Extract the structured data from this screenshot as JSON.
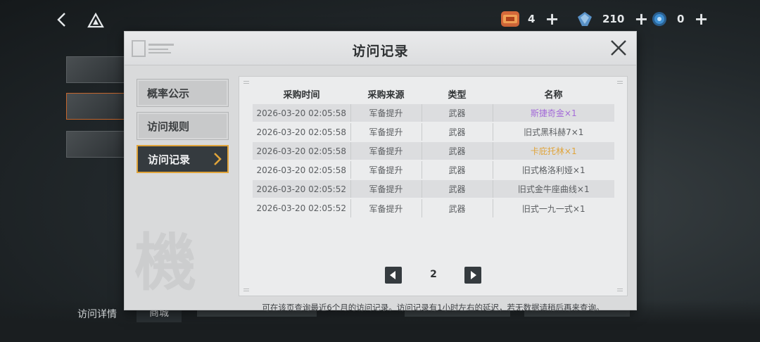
{
  "topbar": {
    "resources": [
      {
        "icon": "ticket-icon",
        "value": "4",
        "color": "#d4683a"
      },
      {
        "icon": "crystal-icon",
        "value": "210",
        "color": "#5a93c9"
      },
      {
        "icon": "coin-icon",
        "value": "0",
        "color": "#3e8fd2"
      }
    ]
  },
  "background": {
    "tab_details": "访问详情",
    "tab_shop": "商城"
  },
  "modal": {
    "title": "访问记录",
    "sidebar": [
      {
        "label": "概率公示",
        "active": false
      },
      {
        "label": "访问规则",
        "active": false
      },
      {
        "label": "访问记录",
        "active": true
      }
    ],
    "decor_kanji": "機",
    "table": {
      "headers": [
        "采购时间",
        "采购来源",
        "类型",
        "名称"
      ],
      "rows": [
        {
          "time": "2026-03-20 02:05:58",
          "source": "军备提升",
          "type": "武器",
          "name": "斯捷奇金×1",
          "name_color": "#a36ad8"
        },
        {
          "time": "2026-03-20 02:05:58",
          "source": "军备提升",
          "type": "武器",
          "name": "旧式黑科赫7×1",
          "name_color": "#5a5d60"
        },
        {
          "time": "2026-03-20 02:05:58",
          "source": "军备提升",
          "type": "武器",
          "name": "卡庇托林×1",
          "name_color": "#e0a43a"
        },
        {
          "time": "2026-03-20 02:05:58",
          "source": "军备提升",
          "type": "武器",
          "name": "旧式格洛利娅×1",
          "name_color": "#5a5d60"
        },
        {
          "time": "2026-03-20 02:05:52",
          "source": "军备提升",
          "type": "武器",
          "name": "旧式金牛座曲线×1",
          "name_color": "#5a5d60"
        },
        {
          "time": "2026-03-20 02:05:52",
          "source": "军备提升",
          "type": "武器",
          "name": "旧式一九一式×1",
          "name_color": "#5a5d60"
        }
      ]
    },
    "pager": {
      "page": "2"
    },
    "note": "可在该页查询最近6个月的访问记录。访问记录有1小时左右的延迟，若无数据请稍后再来查询。"
  }
}
